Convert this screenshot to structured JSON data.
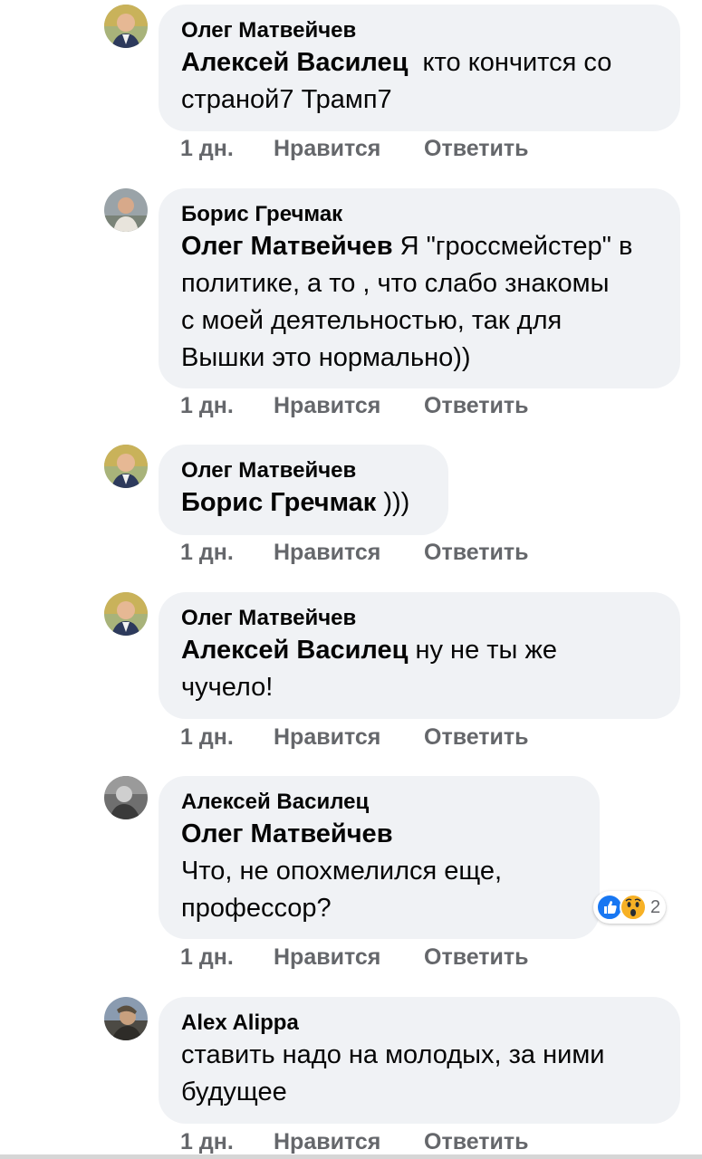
{
  "comments": [
    {
      "author": "Олег Матвейчев",
      "mention": "Алексей Василец",
      "text_line1": "кто кончится со",
      "text_line2": "страной7 Трамп7",
      "time": "1 дн.",
      "like": "Нравится",
      "reply": "Ответить",
      "avatar_icon": "avatar-oleg-icon"
    },
    {
      "author": "Борис Гречмак",
      "mention": "Олег Матвейчев",
      "text_line1": "Я \"гроссмейстер\" в",
      "text_line2": "политике, а то , что слабо знакомы",
      "text_line3": "с моей деятельностью, так для",
      "text_line4": "Вышки это нормально))",
      "time": "1 дн.",
      "like": "Нравится",
      "reply": "Ответить",
      "avatar_icon": "avatar-boris-icon"
    },
    {
      "author": "Олег Матвейчев",
      "mention": "Борис Гречмак",
      "text_line1": ")))",
      "time": "1 дн.",
      "like": "Нравится",
      "reply": "Ответить",
      "avatar_icon": "avatar-oleg-icon"
    },
    {
      "author": "Олег Матвейчев",
      "mention": "Алексей Василец",
      "text_line1": "ну не ты же",
      "text_line2": "чучело!",
      "time": "1 дн.",
      "like": "Нравится",
      "reply": "Ответить",
      "avatar_icon": "avatar-oleg-icon"
    },
    {
      "author": "Алексей Василец",
      "mention": "Олег Матвейчев",
      "text_line1": "Что, не опохмелился еще,",
      "text_line2": "профессор?",
      "time": "1 дн.",
      "like": "Нравится",
      "reply": "Ответить",
      "avatar_icon": "avatar-aleksey-icon",
      "reactions": {
        "icons": [
          "like-reaction-icon",
          "wow-reaction-icon"
        ],
        "count": "2"
      }
    },
    {
      "author": "Alex Alippa",
      "text_line1": "ставить надо на молодых, за ними",
      "text_line2": "будущее",
      "time": "1 дн.",
      "like": "Нравится",
      "reply": "Ответить",
      "avatar_icon": "avatar-alex-icon"
    }
  ],
  "colors": {
    "bubble": "#f0f2f5",
    "text": "#050505",
    "meta": "#65676b",
    "like_blue": "#1877f2",
    "wow_yellow": "#f7b125"
  }
}
